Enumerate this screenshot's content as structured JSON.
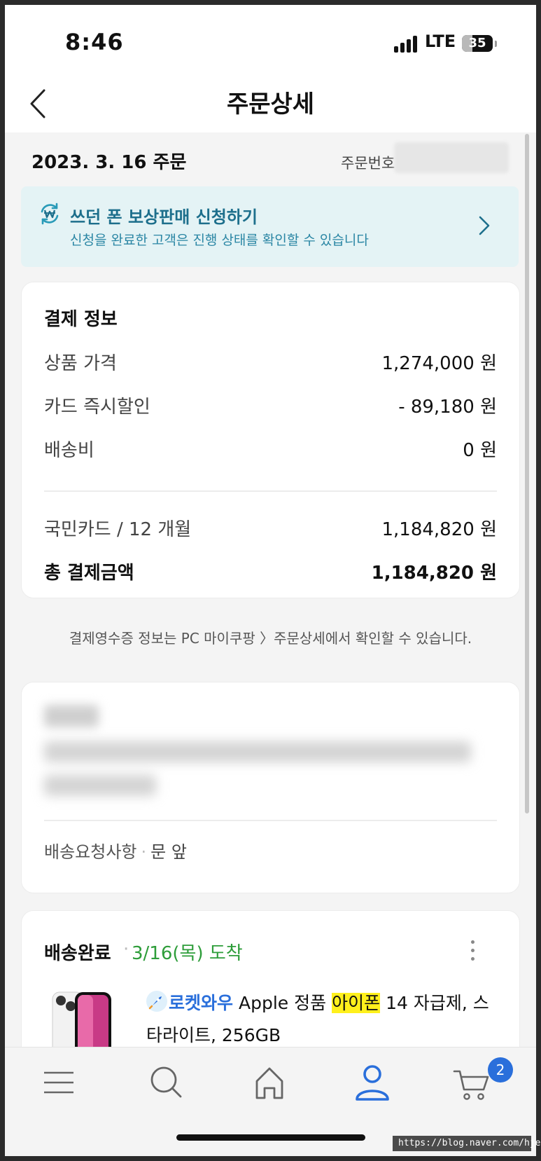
{
  "status_bar": {
    "time": "8:46",
    "network": "LTE",
    "battery": "35"
  },
  "header": {
    "title": "주문상세"
  },
  "order": {
    "date": "2023. 3. 16 주문",
    "number_label": "주문번호"
  },
  "trade_in_banner": {
    "title": "쓰던 폰 보상판매 신청하기",
    "subtitle": "신청을 완료한 고객은 진행 상태를 확인할 수 있습니다"
  },
  "payment": {
    "title": "결제 정보",
    "rows": [
      {
        "label": "상품 가격",
        "value": "1,274,000 원"
      },
      {
        "label": "카드 즉시할인",
        "value": "- 89,180 원"
      },
      {
        "label": "배송비",
        "value": "0 원"
      }
    ],
    "method": {
      "label": "국민카드 / 12 개월",
      "value": "1,184,820 원"
    },
    "total": {
      "label": "총 결제금액",
      "value": "1,184,820 원"
    }
  },
  "receipt_notice": "결제영수증 정보는 PC 마이쿠팡 〉주문상세에서 확인할 수 있습니다.",
  "delivery_address": {
    "request_label": "배송요청사항",
    "request_value": "문 앞"
  },
  "shipment": {
    "status": "배송완료",
    "arrival": "3/16(목) 도착",
    "product": {
      "badge_label": "로켓와우",
      "name_prefix": "Apple 정품",
      "name_highlight": "아이폰",
      "name_suffix": "14 자급제, 스",
      "name_line2": "타라이트, 256GB"
    }
  },
  "bottom_nav": {
    "items": [
      "menu-icon",
      "search-icon",
      "home-icon",
      "my-coupang-icon",
      "cart-icon"
    ],
    "cart_count": "2",
    "active_color": "#2a6fdb"
  },
  "watermark": "https://blog.naver.com/hjee__"
}
